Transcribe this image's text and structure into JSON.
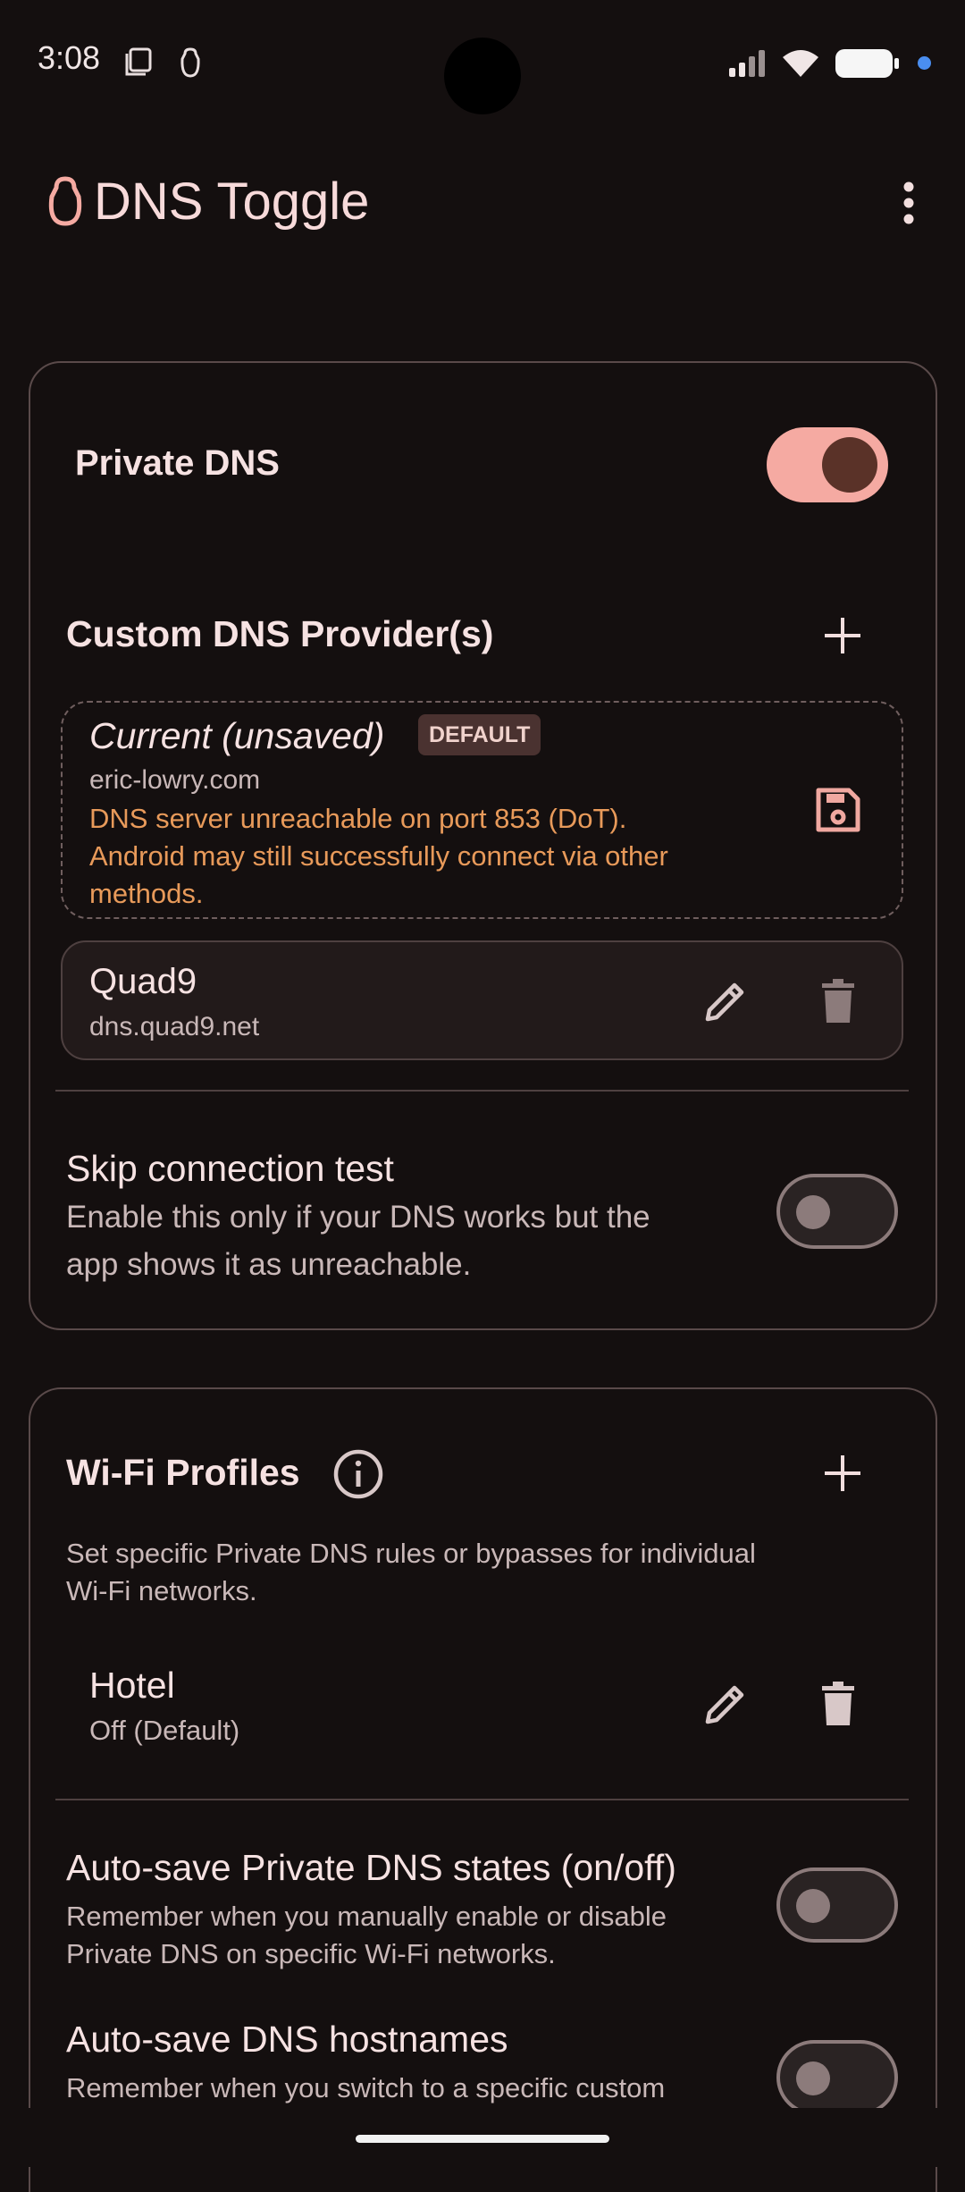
{
  "status_bar": {
    "time": "3:08"
  },
  "app": {
    "title": "DNS Toggle"
  },
  "private_dns": {
    "label": "Private DNS",
    "enabled": true
  },
  "providers": {
    "heading": "Custom DNS Provider(s)",
    "current": {
      "title": "Current (unsaved)",
      "badge": "DEFAULT",
      "host": "eric-lowry.com",
      "warning_line1": "DNS server unreachable on port 853 (DoT).",
      "warning_line2": "Android may still successfully connect via other",
      "warning_line3": "methods."
    },
    "saved": [
      {
        "name": "Quad9",
        "host": "dns.quad9.net"
      }
    ]
  },
  "skip_test": {
    "title": "Skip connection test",
    "desc_line1": "Enable this only if your DNS works but the",
    "desc_line2": "app shows it as unreachable.",
    "enabled": false
  },
  "wifi": {
    "heading": "Wi-Fi Profiles",
    "desc_line1": "Set specific Private DNS rules or bypasses for individual",
    "desc_line2": "Wi-Fi networks.",
    "profiles": [
      {
        "name": "Hotel",
        "state": "Off (Default)"
      }
    ]
  },
  "autosave_state": {
    "title": "Auto-save Private DNS states (on/off)",
    "desc_line1": "Remember when you manually enable or disable",
    "desc_line2": "Private DNS on specific Wi-Fi networks.",
    "enabled": false
  },
  "autosave_host": {
    "title": "Auto-save DNS hostnames",
    "desc_line1": "Remember when you switch to a specific custom",
    "enabled": false
  },
  "colors": {
    "accent": "#f5aaa2",
    "warning": "#e89a5a",
    "background": "#140f0f"
  }
}
